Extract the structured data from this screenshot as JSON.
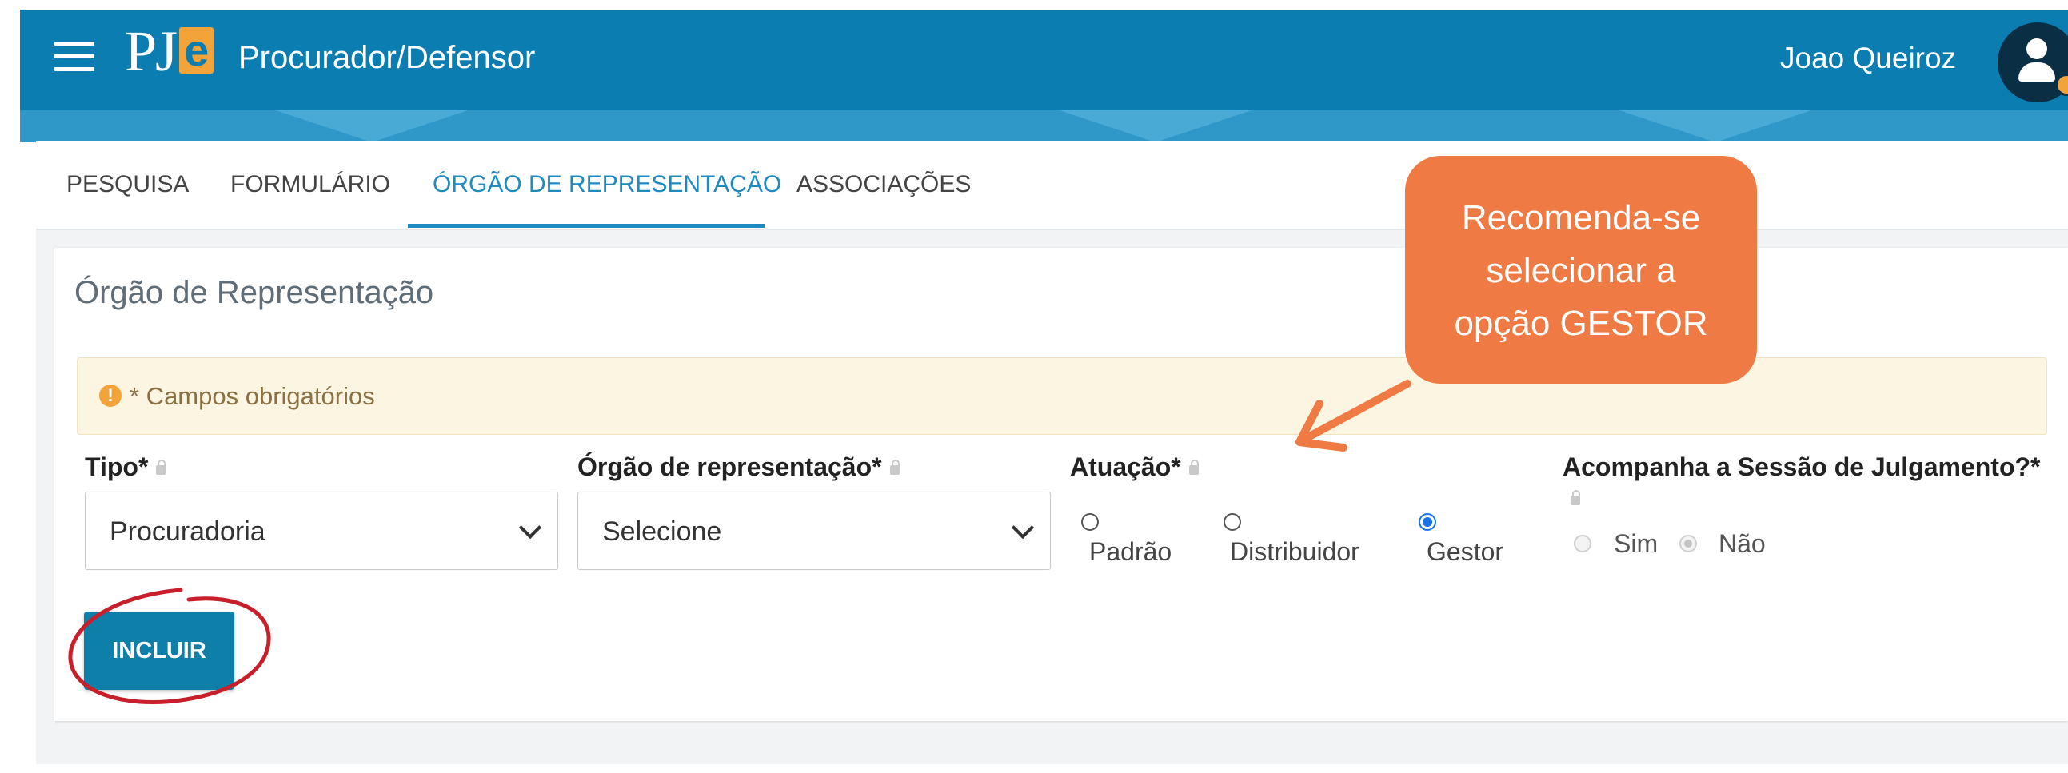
{
  "header": {
    "logo_pj": "PJ",
    "logo_e": "e",
    "app_title": "Procurador/Defensor",
    "user_name": "Joao Queiroz"
  },
  "tabs": [
    {
      "label": "PESQUISA",
      "active": false
    },
    {
      "label": "FORMULÁRIO",
      "active": false
    },
    {
      "label": "ÓRGÃO DE REPRESENTAÇÃO",
      "active": true
    },
    {
      "label": "ASSOCIAÇÕES",
      "active": false
    }
  ],
  "card": {
    "title": "Órgão de Representação",
    "required_notice": "* Campos obrigatórios",
    "alert_icon": "!"
  },
  "fields": {
    "tipo": {
      "label": "Tipo*",
      "value": "Procuradoria"
    },
    "orgao": {
      "label": "Órgão de representação*",
      "value": "Selecione"
    },
    "atuacao": {
      "label": "Atuação*",
      "options": [
        "Padrão",
        "Distribuidor",
        "Gestor"
      ],
      "selected": "Gestor"
    },
    "acompanha": {
      "label": "Acompanha a Sessão de Julgamento?*",
      "options": [
        "Sim",
        "Não"
      ],
      "selected": "Não"
    }
  },
  "buttons": {
    "incluir": "INCLUIR"
  },
  "annotations": {
    "callout_lines": [
      "Recomenda-se",
      "selecionar a",
      "opção GESTOR"
    ]
  },
  "colors": {
    "header": "#0b7db0",
    "tab_active": "#1d8bbf",
    "button": "#0d7fa8",
    "callout": "#f07a43",
    "annotation_red": "#c8202a",
    "radio_selected": "#1a73e8"
  }
}
